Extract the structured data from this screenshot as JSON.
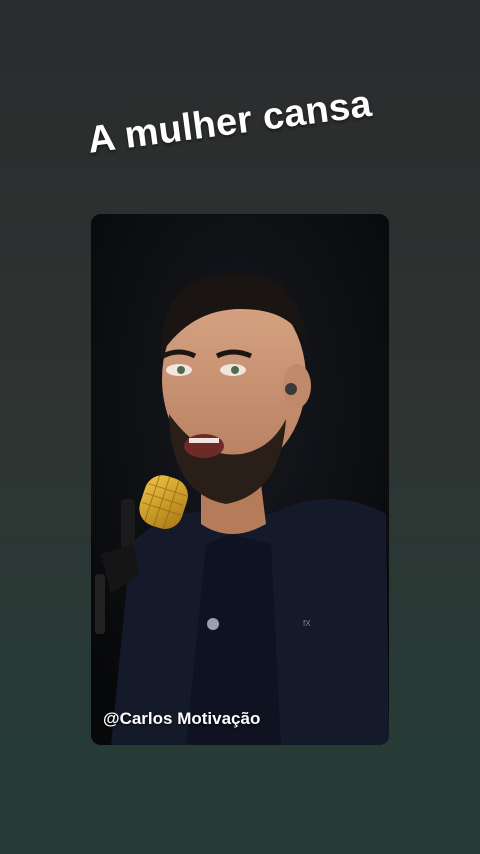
{
  "caption": {
    "title": "A mulher cansa"
  },
  "video": {
    "watermark": "@Carlos Motivação"
  }
}
